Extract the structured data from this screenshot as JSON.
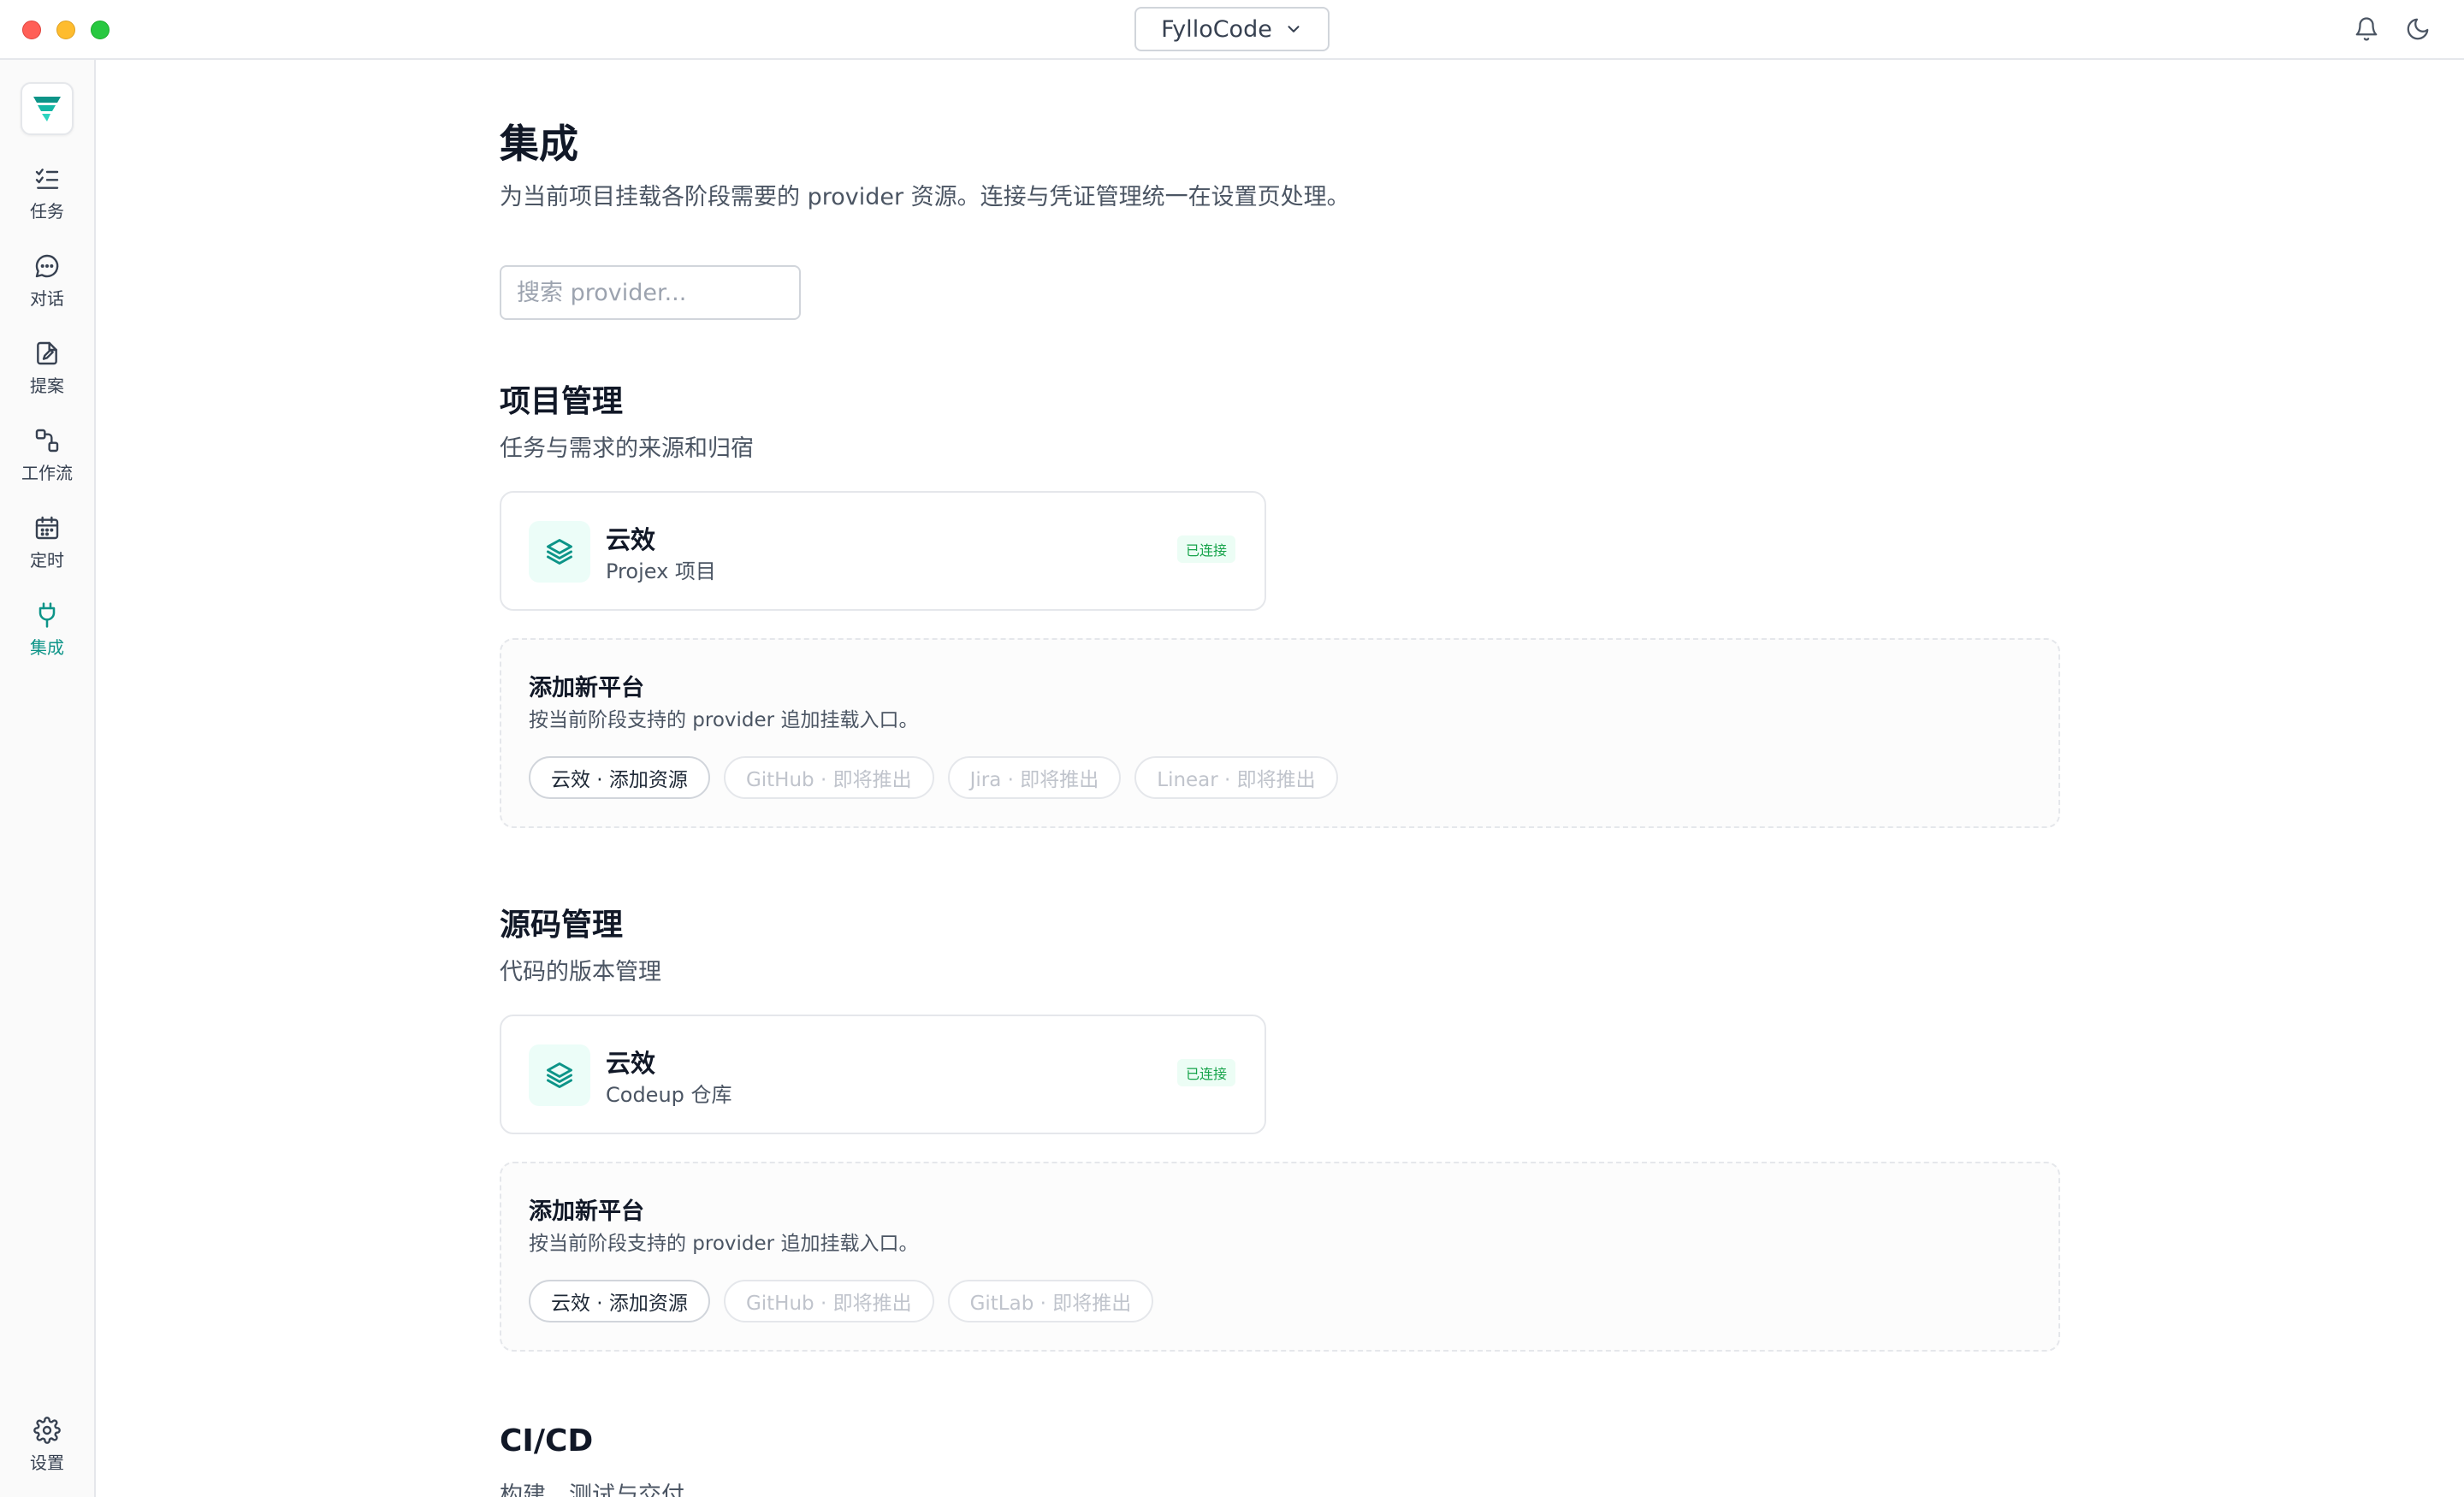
{
  "titlebar": {
    "workspace": "FylloCode"
  },
  "sidebar": {
    "items": [
      {
        "label": "任务",
        "icon": "task-list-icon"
      },
      {
        "label": "对话",
        "icon": "chat-bubble-icon"
      },
      {
        "label": "提案",
        "icon": "document-edit-icon"
      },
      {
        "label": "工作流",
        "icon": "workflow-icon"
      },
      {
        "label": "定时",
        "icon": "calendar-icon"
      },
      {
        "label": "集成",
        "icon": "plug-icon"
      }
    ],
    "settings_label": "设置",
    "active": "集成",
    "accent_color": "#0d9488"
  },
  "page": {
    "title": "集成",
    "subtitle": "为当前项目挂载各阶段需要的 provider 资源。连接与凭证管理统一在设置页处理。",
    "search_placeholder": "搜索 provider..."
  },
  "sections": [
    {
      "title": "项目管理",
      "subtitle": "任务与需求的来源和归宿",
      "card": {
        "name": "云效",
        "desc": "Projex 项目",
        "badge": "已连接"
      },
      "add": {
        "title": "添加新平台",
        "subtitle": "按当前阶段支持的 provider 追加挂载入口。",
        "chips": [
          "云效 · 添加资源",
          "GitHub · 即将推出",
          "Jira · 即将推出",
          "Linear · 即将推出"
        ]
      }
    },
    {
      "title": "源码管理",
      "subtitle": "代码的版本管理",
      "card": {
        "name": "云效",
        "desc": "Codeup 仓库",
        "badge": "已连接"
      },
      "add": {
        "title": "添加新平台",
        "subtitle": "按当前阶段支持的 provider 追加挂载入口。",
        "chips": [
          "云效 · 添加资源",
          "GitHub · 即将推出",
          "GitLab · 即将推出"
        ]
      }
    },
    {
      "title": "CI/CD",
      "subtitle": "构建、测试与交付"
    }
  ]
}
